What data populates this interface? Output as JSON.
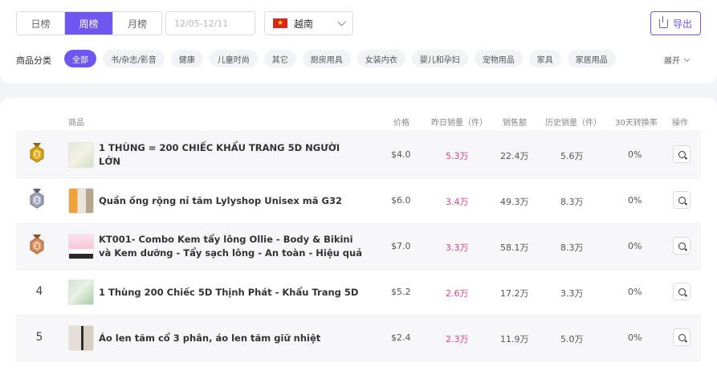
{
  "period_tabs": [
    {
      "label": "日榜",
      "active": false
    },
    {
      "label": "周榜",
      "active": true
    },
    {
      "label": "月榜",
      "active": false
    }
  ],
  "date_range": {
    "placeholder": "12/05-12/11"
  },
  "country": {
    "label": "越南",
    "flag": "vietnam-flag-icon"
  },
  "export_label": "导出",
  "category": {
    "label": "商品分类",
    "chips": [
      "全部",
      "书/杂志/影音",
      "健康",
      "儿童时尚",
      "其它",
      "厨房用具",
      "女装内衣",
      "婴儿和孕妇",
      "宠物用品",
      "家具",
      "家居用品"
    ],
    "active_index": 0,
    "expand_label": "展开"
  },
  "table": {
    "headers": {
      "product": "商品",
      "price": "价格",
      "yesterday_sales": "昨日销量（件）",
      "sales_amount": "销售额",
      "history_sales": "历史销量（件）",
      "conversion_30d": "30天转换率",
      "actions": "操作"
    },
    "rows": [
      {
        "rank": "1",
        "medal": "gold",
        "name": "1 THÙNG = 200 CHIẾC KHẨU TRANG 5D NGƯỜI LỚN",
        "price": "$4.0",
        "yesterday": "5.3万",
        "sales": "22.4万",
        "history": "5.6万",
        "conversion": "0%"
      },
      {
        "rank": "2",
        "medal": "silver",
        "name": "Quần ống rộng nỉ tăm Lylyshop Unisex mã G32",
        "price": "$6.0",
        "yesterday": "3.4万",
        "sales": "49.3万",
        "history": "8.3万",
        "conversion": "0%"
      },
      {
        "rank": "3",
        "medal": "bronze",
        "name": "KT001- Combo Kem tẩy lông Ollie - Body & Bikini và Kem dưỡng - Tẩy sạch lông - An toàn - Hiệu quả",
        "price": "$7.0",
        "yesterday": "3.3万",
        "sales": "58.1万",
        "history": "8.3万",
        "conversion": "0%"
      },
      {
        "rank": "4",
        "medal": "",
        "name": "1 Thùng 200 Chiếc 5D Thịnh Phát - Khẩu Trang 5D",
        "price": "$5.2",
        "yesterday": "2.6万",
        "sales": "17.2万",
        "history": "3.3万",
        "conversion": "0%"
      },
      {
        "rank": "5",
        "medal": "",
        "name": "Áo len tăm cổ 3 phân, áo len tăm giữ nhiệt",
        "price": "$2.4",
        "yesterday": "2.3万",
        "sales": "11.9万",
        "history": "5.0万",
        "conversion": "0%"
      }
    ]
  },
  "colors": {
    "accent": "#6f56f0",
    "pink_value": "#d9428d",
    "gold": "#d4a017",
    "silver": "#9aa0b5",
    "bronze": "#d08a5a"
  }
}
